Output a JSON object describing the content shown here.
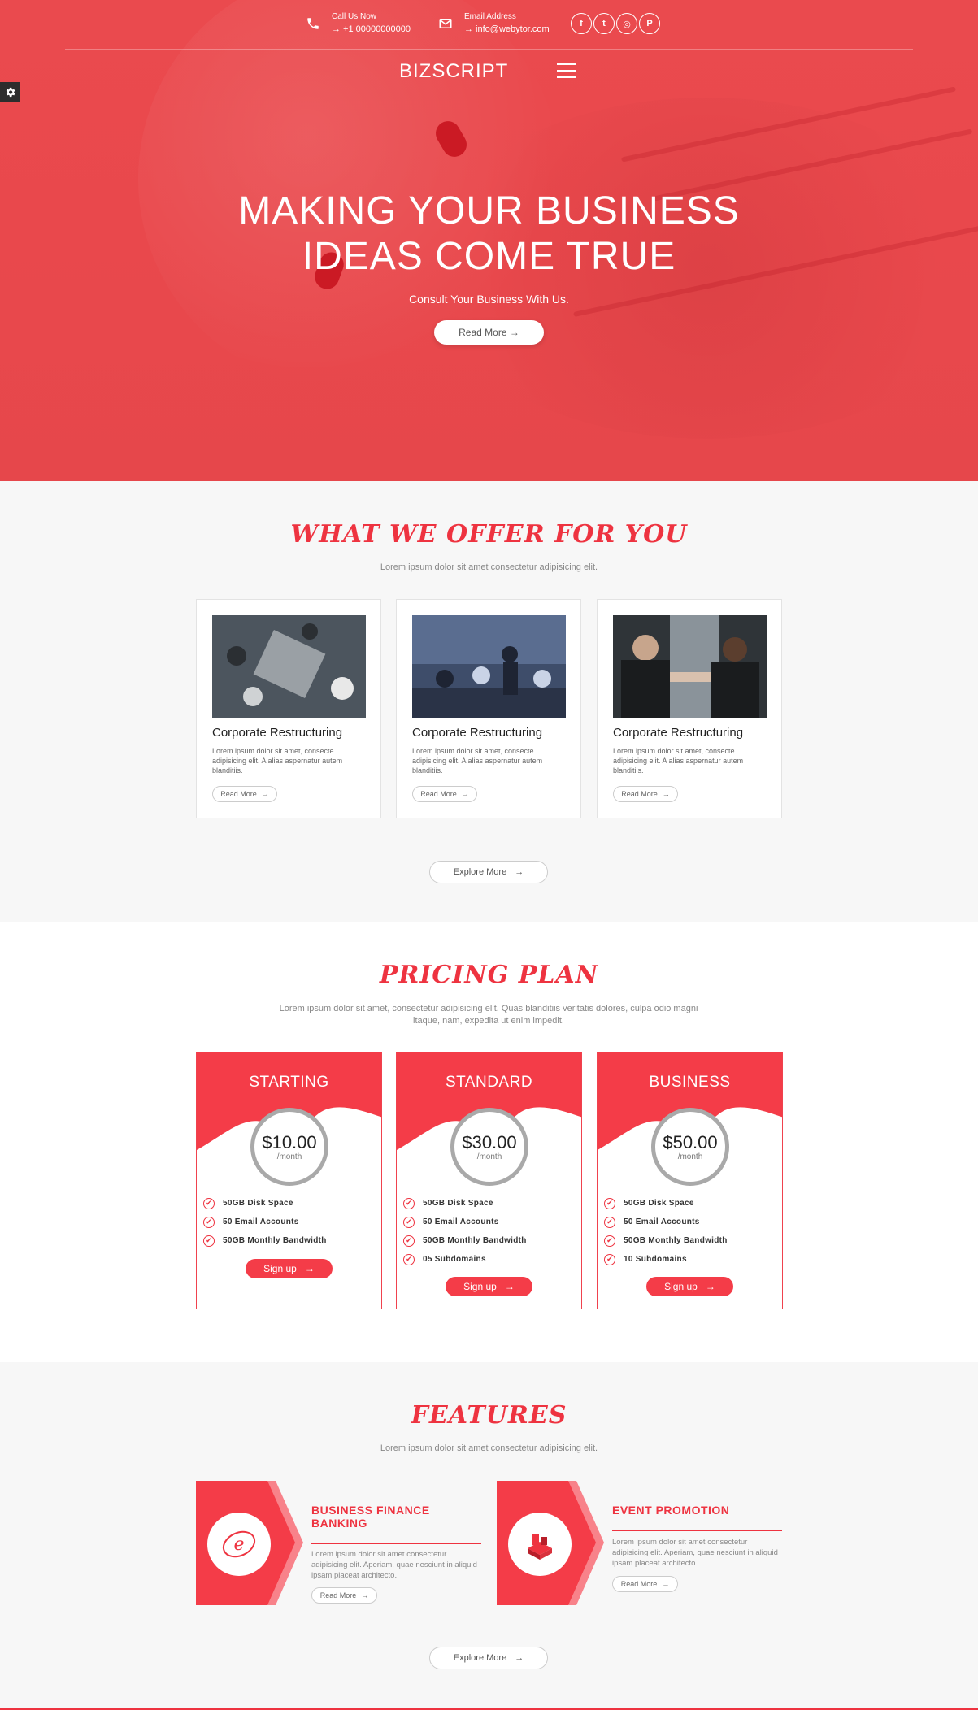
{
  "topbar": {
    "phone_label": "Call Us Now",
    "phone_value": "→ +1 00000000000",
    "email_label": "Email Address",
    "email_value": "→ info@webytor.com",
    "socials": [
      "f",
      "t",
      "◎",
      "P"
    ]
  },
  "brand": "BIZSCRIPT",
  "hero": {
    "title_line1": "MAKING YOUR BUSINESS",
    "title_line2": "IDEAS COME TRUE",
    "subtitle": "Consult Your Business With Us.",
    "button": "Read More →"
  },
  "offer": {
    "title": "What we offer for you",
    "subtitle": "Lorem ipsum dolor sit amet consectetur adipisicing elit.",
    "cards": [
      {
        "title": "Corporate Restructuring",
        "desc": "Lorem ipsum dolor sit amet, consecte adipisicing elit. A alias aspernatur autem blanditiis.",
        "button": "Read More"
      },
      {
        "title": "Corporate Restructuring",
        "desc": "Lorem ipsum dolor sit amet, consecte adipisicing elit. A alias aspernatur autem blanditiis.",
        "button": "Read More"
      },
      {
        "title": "Corporate Restructuring",
        "desc": "Lorem ipsum dolor sit amet, consecte adipisicing elit. A alias aspernatur autem blanditiis.",
        "button": "Read More"
      }
    ],
    "explore": "Explore More"
  },
  "pricing": {
    "title": "Pricing Plan",
    "subtitle": "Lorem ipsum dolor sit amet, consectetur adipisicing elit. Quas blanditiis veritatis dolores, culpa odio magni itaque, nam, expedita ut enim impedit.",
    "plans": [
      {
        "name": "STARTING",
        "price": "$10.00",
        "period": "/month",
        "features": [
          "50GB Disk Space",
          "50 Email Accounts",
          "50GB Monthly Bandwidth"
        ],
        "button": "Sign up"
      },
      {
        "name": "STANDARD",
        "price": "$30.00",
        "period": "/month",
        "features": [
          "50GB Disk Space",
          "50 Email Accounts",
          "50GB Monthly Bandwidth",
          "05 Subdomains"
        ],
        "button": "Sign up"
      },
      {
        "name": "BUSINESS",
        "price": "$50.00",
        "period": "/month",
        "features": [
          "50GB Disk Space",
          "50 Email Accounts",
          "50GB Monthly Bandwidth",
          "10 Subdomains"
        ],
        "button": "Sign up"
      }
    ]
  },
  "features": {
    "title": "Features",
    "subtitle": "Lorem ipsum dolor sit amet consectetur adipisicing elit.",
    "items": [
      {
        "title_line1": "BUSINESS FINANCE",
        "title_line2": "BANKING",
        "desc": "Lorem ipsum dolor sit amet consectetur adipisicing elit. Aperiam, quae nesciunt in aliquid ipsam placeat architecto.",
        "button": "Read More"
      },
      {
        "title_line1": "EVENT PROMOTION",
        "title_line2": "",
        "desc": "Lorem ipsum dolor sit amet consectetur adipisicing elit. Aperiam, quae nesciunt in aliquid ipsam placeat architecto.",
        "button": "Read More"
      }
    ],
    "explore": "Explore More"
  },
  "colors": {
    "accent": "#ee3340",
    "hero": "#ea4a4e"
  }
}
